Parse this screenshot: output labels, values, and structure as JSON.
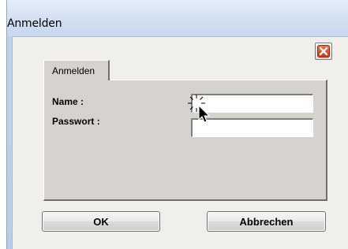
{
  "window": {
    "title": "Anmelden"
  },
  "tab": {
    "label": "Anmelden"
  },
  "form": {
    "name_label": "Name :",
    "name_value": "",
    "password_label": "Passwort :",
    "password_value": ""
  },
  "buttons": {
    "ok_label": "OK",
    "cancel_label": "Abbrechen"
  },
  "icons": {
    "close": "close-icon",
    "cursor": "busy-cursor-icon"
  }
}
